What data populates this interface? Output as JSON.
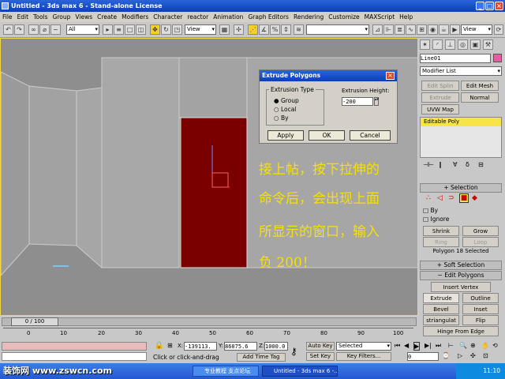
{
  "title": "Untitled - 3ds max 6 - Stand-alone License",
  "menu": [
    "File",
    "Edit",
    "Tools",
    "Group",
    "Views",
    "Create",
    "Modifiers",
    "Character",
    "reactor",
    "Animation",
    "Graph Editors",
    "Rendering",
    "Customize",
    "MAXScript",
    "Help"
  ],
  "toolbar": {
    "selection_filter": "All",
    "coord_system": "View",
    "coord_system2": "View"
  },
  "dialog": {
    "title": "Extrude Polygons",
    "group_label": "Extrusion Type",
    "options": [
      "Group",
      "Local",
      "By"
    ],
    "height_label": "Extrusion Height:",
    "height_value": "-200",
    "apply": "Apply",
    "ok": "OK",
    "cancel": "Cancel"
  },
  "overlay_text": [
    "接上帖，按下拉伸的",
    "命令后，会出现上面",
    "所显示的窗口，输入",
    "负 200！"
  ],
  "panel": {
    "object_name": "Line01",
    "modifier_list": "Modifier List",
    "btns": [
      "Edit Splin",
      "Edit Mesh",
      "Extrude",
      "Normal",
      "UVW Map"
    ],
    "stack_item": "Editable Poly",
    "selection_hdr": "Selection",
    "by_label": "By",
    "ignore_label": "Ignore",
    "shrink": "Shrink",
    "grow": "Grow",
    "ring": "Ring",
    "loop": "Loop",
    "sel_status": "Polygon 18 Selected",
    "soft_sel": "Soft Selection",
    "edit_poly": "Edit Polygons",
    "insert_vertex": "Insert Vertex",
    "extrude": "Extrude",
    "outline": "Outline",
    "bevel": "Bevel",
    "inset": "Inset",
    "triangulate": "striangulat",
    "flip": "Flip",
    "hinge": "Hinge From Edge"
  },
  "timeline": {
    "frame": "0 / 100",
    "ticks": [
      "0",
      "10",
      "20",
      "30",
      "40",
      "50",
      "60",
      "70",
      "80",
      "90",
      "100"
    ]
  },
  "status": {
    "x": "-139113.",
    "y": "86075.6",
    "z": "1000.0",
    "prompt": "Click or click-and-drag",
    "add_time_tag": "Add Time Tag",
    "auto_key": "Auto Key",
    "selected": "Selected",
    "set_key": "Set Key",
    "key_filters": "Key Filters...",
    "frame_field": "0"
  },
  "taskbar": {
    "watermark": "装饰网 www.zswcn.com",
    "item1": "专业教程 支点论坛",
    "item2": "Untitled - 3ds max 6 -...",
    "clock": "11:10"
  },
  "colors": {
    "accent": "#f6e100",
    "poly": "#7a0000",
    "title_blue": "#0a3fb8"
  }
}
